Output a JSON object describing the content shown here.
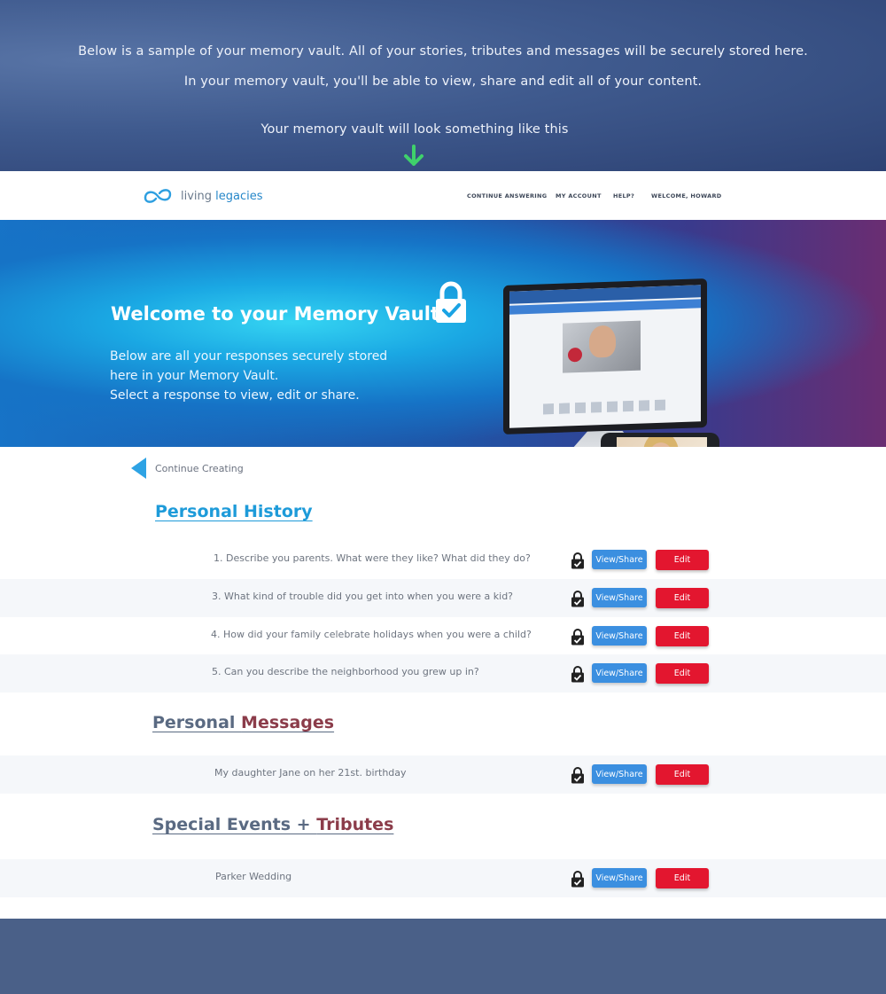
{
  "intro": {
    "line1": "Below is a sample  of your memory vault. All of your stories, tributes and messages will be securely stored here.",
    "line2": "In your memory vault, you'll be able to view, share and edit all of your content.",
    "line3": "Your memory vault will look something like this"
  },
  "nav": {
    "brand_light": "living ",
    "brand_bold": "legacies",
    "links": [
      "CONTINUE ANSWERING",
      "MY ACCOUNT",
      "HELP?",
      "WELCOME, HOWARD"
    ]
  },
  "hero": {
    "title": "Welcome to your Memory Vault!",
    "desc_lines": [
      "Below are all your responses securely stored",
      "here in your Memory Vault.",
      "Select a response to view, edit or share."
    ]
  },
  "back_link": "Continue Creating",
  "buttons": {
    "view": "View/Share",
    "edit": "Edit"
  },
  "sections": [
    {
      "title": "Personal History",
      "items": [
        "1. Describe you parents. What were they like? What did they do?",
        "3. What kind of trouble did you get into when you were a kid?",
        "4. How did your family celebrate holidays when you were a child?",
        "5. Can you describe the neighborhood you grew up in?"
      ]
    },
    {
      "title_a": "Personal ",
      "title_b": "Messages",
      "items": [
        "My daughter Jane on her 21st. birthday"
      ]
    },
    {
      "title_a": "Special Events + ",
      "title_b": "Tributes",
      "items": [
        "Parker Wedding"
      ]
    }
  ],
  "colors": {
    "accent_blue": "#1e9bd9",
    "edit_red": "#e3162f",
    "view_blue": "#3b8fe0",
    "arrow_green": "#3fd16b"
  }
}
